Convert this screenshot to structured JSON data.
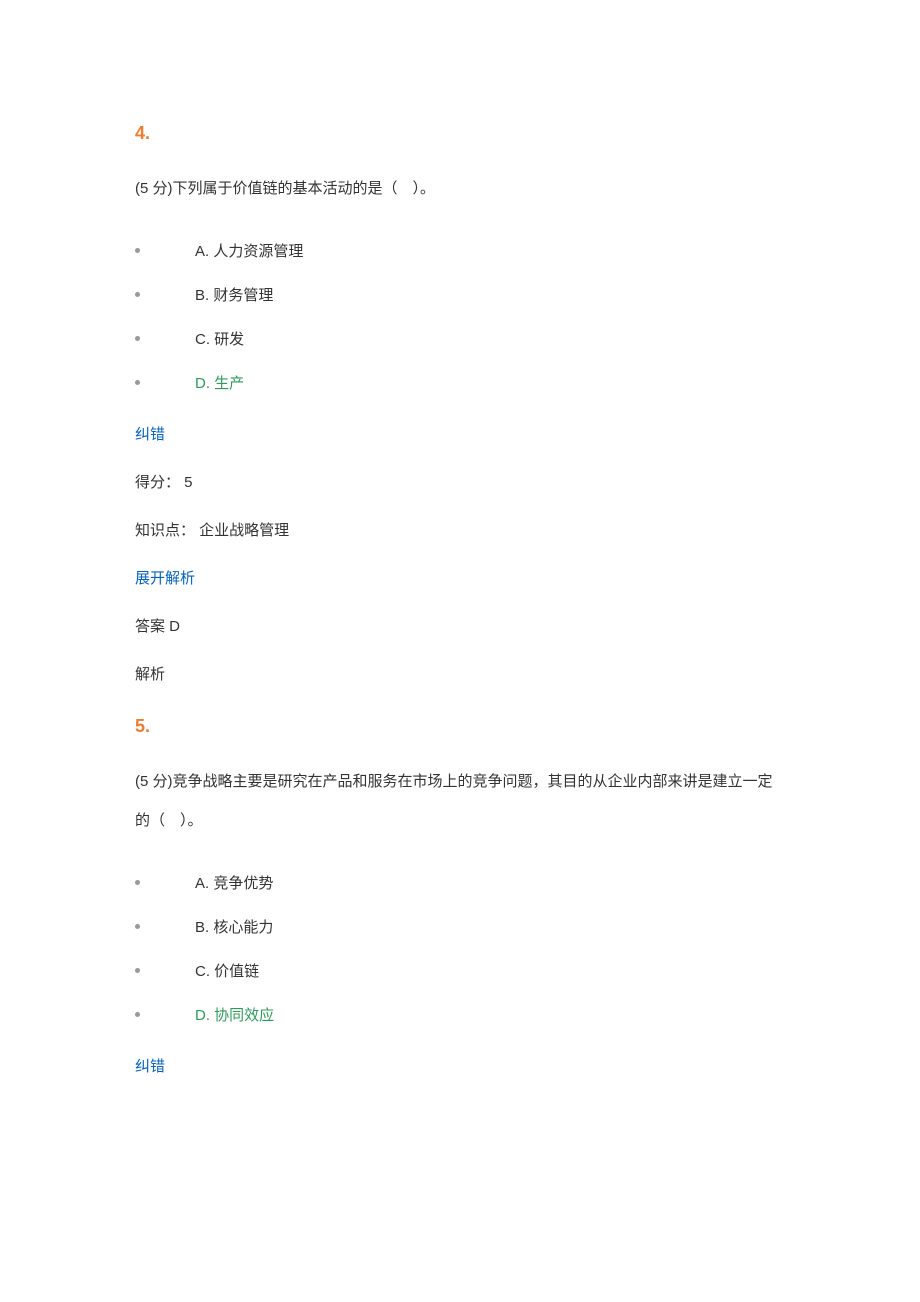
{
  "q4": {
    "number": "4.",
    "stem": "(5 分)下列属于价值链的基本活动的是（　）。",
    "options": {
      "A": "A. 人力资源管理",
      "B": "B. 财务管理",
      "C": "C. 研发",
      "D": "D. 生产"
    },
    "correctionLink": "纠错",
    "scoreLine": "得分： 5",
    "kpLine": "知识点： 企业战略管理",
    "expandLink": "展开解析",
    "answerLine": "答案 D",
    "analysisLabel": "解析"
  },
  "q5": {
    "number": "5.",
    "stem": "(5 分)竞争战略主要是研究在产品和服务在市场上的竞争问题，其目的从企业内部来讲是建立一定的（　）。",
    "options": {
      "A": "A. 竞争优势",
      "B": "B. 核心能力",
      "C": "C. 价值链",
      "D": "D. 协同效应"
    },
    "correctionLink": "纠错"
  }
}
